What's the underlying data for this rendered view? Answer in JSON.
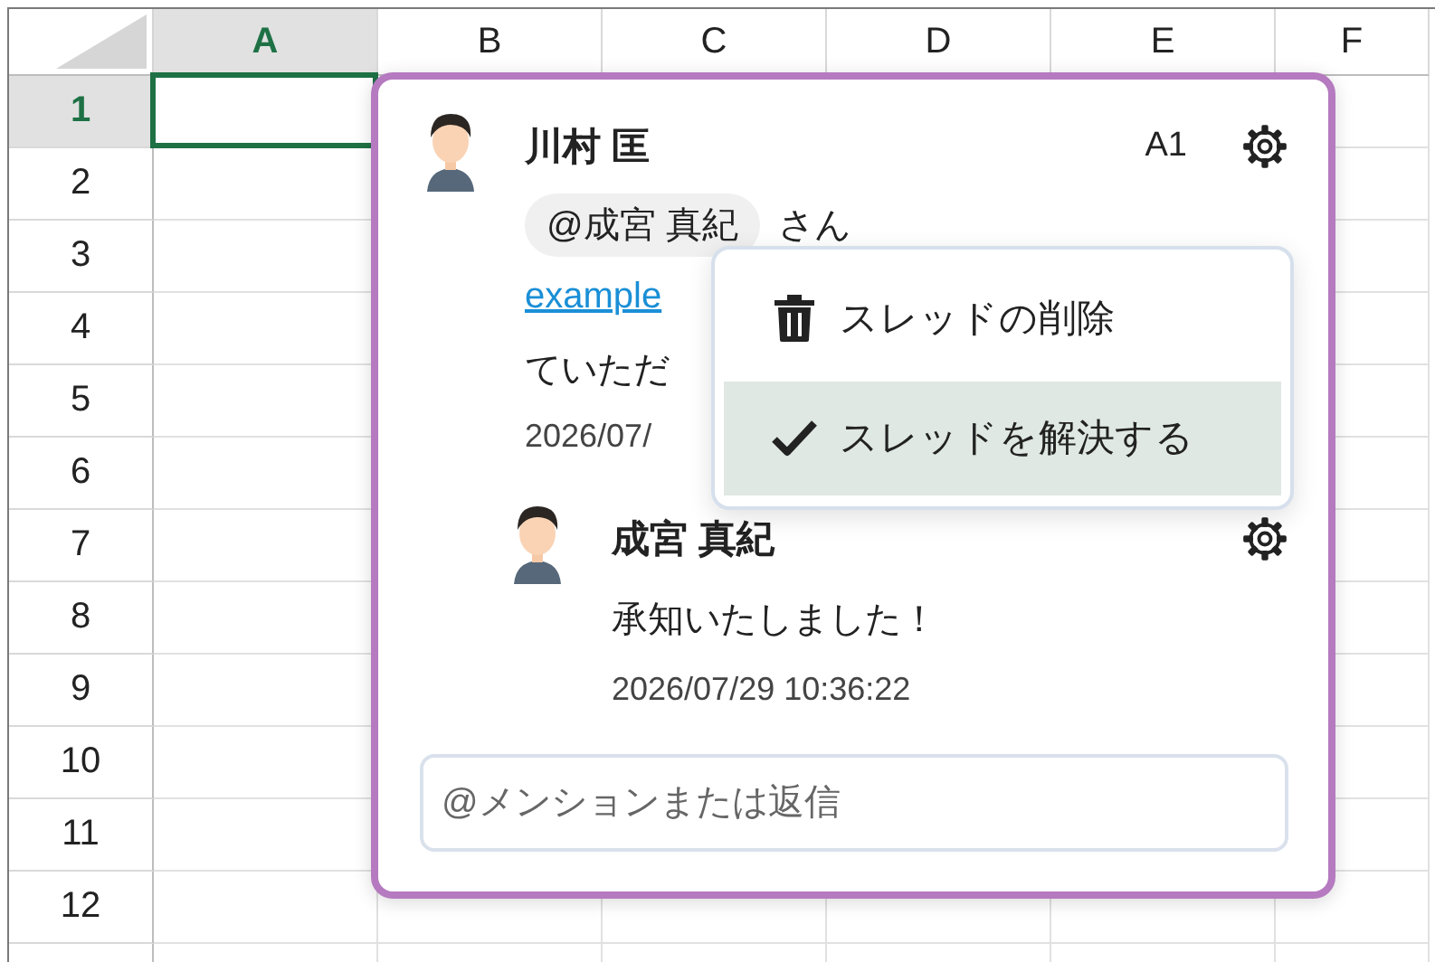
{
  "sheet": {
    "columns": [
      {
        "label": "A",
        "selected": true
      },
      {
        "label": "B",
        "selected": false
      },
      {
        "label": "C",
        "selected": false
      },
      {
        "label": "D",
        "selected": false
      },
      {
        "label": "E",
        "selected": false
      },
      {
        "label": "F",
        "selected": false
      }
    ],
    "rows": [
      {
        "label": "1",
        "selected": true
      },
      {
        "label": "2",
        "selected": false
      },
      {
        "label": "3",
        "selected": false
      },
      {
        "label": "4",
        "selected": false
      },
      {
        "label": "5",
        "selected": false
      },
      {
        "label": "6",
        "selected": false
      },
      {
        "label": "7",
        "selected": false
      },
      {
        "label": "8",
        "selected": false
      },
      {
        "label": "9",
        "selected": false
      },
      {
        "label": "10",
        "selected": false
      },
      {
        "label": "11",
        "selected": false
      },
      {
        "label": "12",
        "selected": false
      }
    ]
  },
  "comment_thread": {
    "cell_ref": "A1",
    "comments": [
      {
        "author": "川村 匡",
        "lines": [
          [
            {
              "kind": "mention",
              "text": "@成宮 真紀"
            },
            {
              "kind": "text",
              "text": "さん"
            }
          ],
          [
            {
              "kind": "link",
              "text": "example"
            }
          ],
          [
            {
              "kind": "text",
              "text": "ていただ"
            }
          ]
        ],
        "time": "2026/07/"
      },
      {
        "author": "成宮 真紀",
        "lines": [
          [
            {
              "kind": "text",
              "text": "承知いたしました！"
            }
          ]
        ],
        "time": "2026/07/29 10:36:22"
      }
    ],
    "reply": {
      "placeholder": "@メンションまたは返信"
    },
    "menu": {
      "items": [
        {
          "kind": "delete",
          "label": "スレッドの削除",
          "highlighted": false
        },
        {
          "kind": "resolve",
          "label": "スレッドを解決する",
          "highlighted": true
        }
      ]
    }
  }
}
